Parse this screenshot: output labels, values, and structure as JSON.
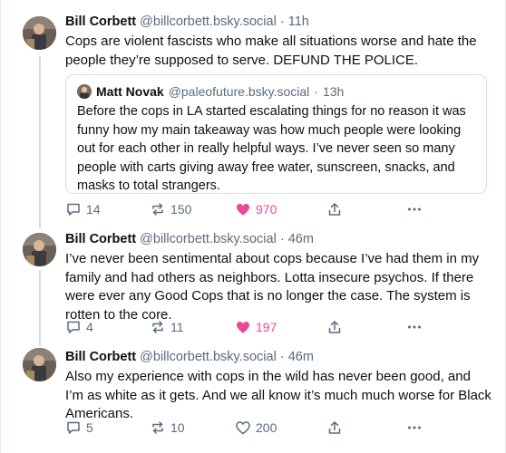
{
  "posts": [
    {
      "author_name": "Bill Corbett",
      "author_handle": "@billcorbett.bsky.social",
      "separator": "·",
      "time": "11h",
      "text": "Cops are violent fascists who make all situations worse and hate the people they’re supposed to serve.  DEFUND THE POLICE.",
      "quote": {
        "author_name": "Matt Novak",
        "author_handle": "@paleofuture.bsky.social",
        "separator": "·",
        "time": "13h",
        "text": "Before the cops in LA started escalating things for no reason it was funny how my main takeaway was how much people were looking out for each other in really helpful ways. I’ve never seen so many people with carts giving away free water, sunscreen, snacks, and masks to total strangers."
      },
      "replies": "14",
      "reposts": "150",
      "likes": "970",
      "liked": true
    },
    {
      "author_name": "Bill Corbett",
      "author_handle": "@billcorbett.bsky.social",
      "separator": "·",
      "time": "46m",
      "text": "I’ve never been sentimental about cops because I’ve had them in my family and had others as neighbors. Lotta insecure psychos. If there were ever any Good Cops that is no longer the case. The system is rotten to the core.",
      "replies": "4",
      "reposts": "11",
      "likes": "197",
      "liked": true
    },
    {
      "author_name": "Bill Corbett",
      "author_handle": "@billcorbett.bsky.social",
      "separator": "·",
      "time": "46m",
      "text": "Also my experience with cops in the wild has never been good, and I’m as white as it gets.  And we all know it’s much much worse for Black Americans.",
      "replies": "5",
      "reposts": "10",
      "likes": "200",
      "liked": false
    }
  ],
  "colors": {
    "like_active": "#ec4899",
    "muted_text": "#5b6b7d",
    "thread_line": "#d5dbe1"
  },
  "icons": {
    "reply": "speech-bubble-icon",
    "repost": "repost-arrows-icon",
    "like": "heart-icon",
    "share": "share-upload-icon",
    "more": "ellipsis-icon"
  }
}
